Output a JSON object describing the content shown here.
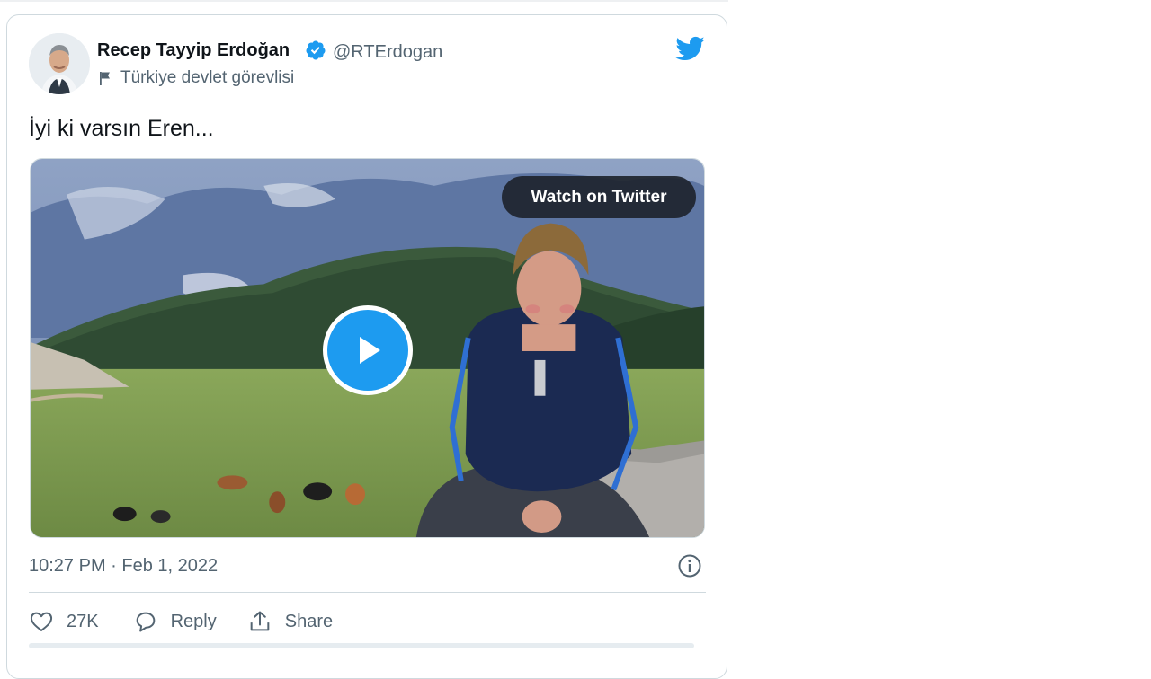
{
  "tweet": {
    "author_name": "Recep Tayyip Erdoğan",
    "handle": "@RTErdogan",
    "label": "Türkiye devlet görevlisi",
    "text": "İyi ki varsın Eren...",
    "timestamp": "10:27 PM · Feb 1, 2022",
    "media": {
      "watch_label": "Watch on Twitter"
    },
    "actions": {
      "like_count": "27K",
      "reply_label": "Reply",
      "share_label": "Share"
    }
  },
  "icons": {
    "verified": "verified-badge-icon",
    "flag": "flag-icon",
    "brand": "twitter-bird-icon",
    "play": "play-icon",
    "info": "info-icon",
    "like": "heart-icon",
    "reply": "speech-bubble-icon",
    "share": "share-upload-icon"
  },
  "colors": {
    "brand_blue": "#1d9bf0",
    "text_primary": "#0f1419",
    "text_secondary": "#536471",
    "border": "#cfd9de"
  }
}
